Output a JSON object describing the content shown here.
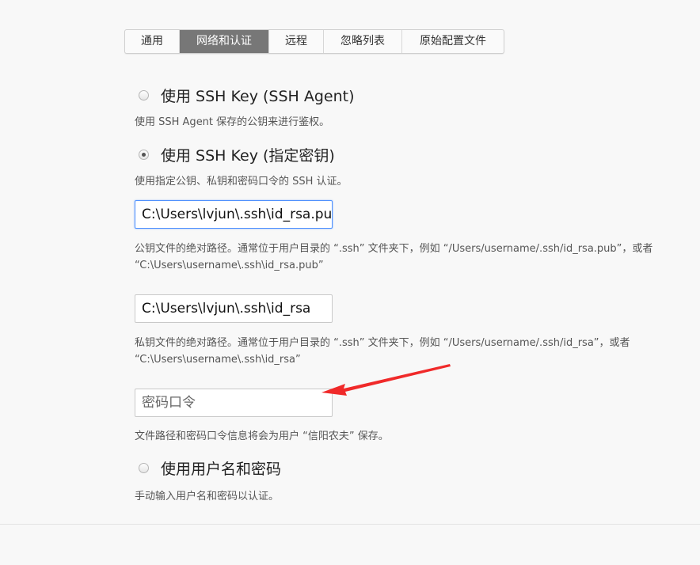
{
  "tabs": [
    {
      "label": "通用",
      "active": false
    },
    {
      "label": "网络和认证",
      "active": true
    },
    {
      "label": "远程",
      "active": false
    },
    {
      "label": "忽略列表",
      "active": false
    },
    {
      "label": "原始配置文件",
      "active": false
    }
  ],
  "auth": {
    "ssh_agent": {
      "label": "使用 SSH Key (SSH Agent)",
      "checked": false,
      "description": "使用 SSH Agent 保存的公钥来进行鉴权。"
    },
    "ssh_key": {
      "label": "使用 SSH Key (指定密钥)",
      "checked": true,
      "description": "使用指定公钥、私钥和密码口令的 SSH 认证。",
      "public_key": {
        "value": "C:\\Users\\lvjun\\.ssh\\id_rsa.pub",
        "help_line1": "公钥文件的绝对路径。通常位于用户目录的 “.ssh” 文件夹下，例如 “/Users/username/.ssh/id_rsa.pub”，或者",
        "help_line2": "“C:\\Users\\username\\.ssh\\id_rsa.pub”"
      },
      "private_key": {
        "value": "C:\\Users\\lvjun\\.ssh\\id_rsa",
        "help_line1": "私钥文件的绝对路径。通常位于用户目录的 “.ssh” 文件夹下，例如 “/Users/username/.ssh/id_rsa”，或者",
        "help_line2": "“C:\\Users\\username\\.ssh\\id_rsa”"
      },
      "passphrase": {
        "placeholder": "密码口令",
        "value": ""
      },
      "save_note": "文件路径和密码口令信息将会为用户 “信阳农夫” 保存。"
    },
    "username_password": {
      "label": "使用用户名和密码",
      "checked": false,
      "description": "手动输入用户名和密码以认证。"
    }
  },
  "annotation": {
    "arrow_color": "#f02a2a",
    "icon": "red-arrow-icon"
  }
}
